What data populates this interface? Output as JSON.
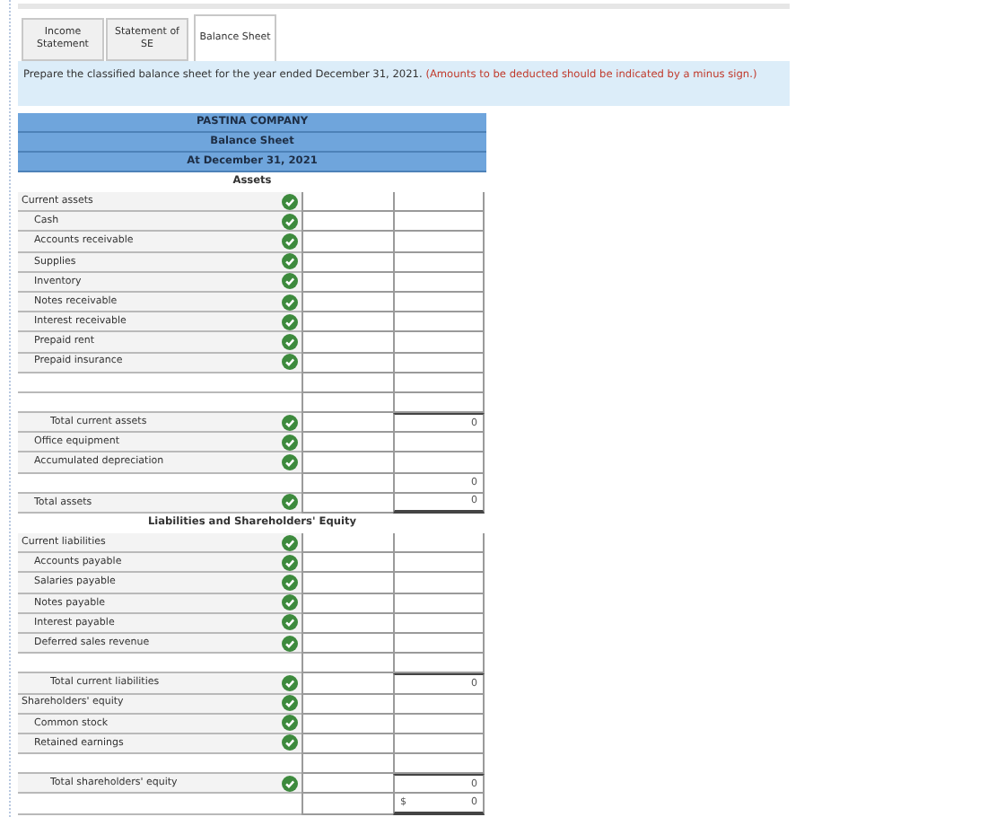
{
  "tabs": [
    {
      "label": "Income Statement",
      "selected": false
    },
    {
      "label": "Statement of SE",
      "selected": false
    },
    {
      "label": "Balance Sheet",
      "selected": true
    }
  ],
  "instructions": {
    "text": "Prepare the classified balance sheet for the year ended December 31, 2021.",
    "note": "(Amounts to be deducted should be indicated by a minus sign.)"
  },
  "sheet": {
    "title_lines": [
      "PASTINA COMPANY",
      "Balance Sheet",
      "At December 31, 2021"
    ],
    "sections": [
      {
        "title": "Assets",
        "rows": [
          {
            "kind": "heading",
            "label": "Current assets",
            "correct": true
          },
          {
            "kind": "item",
            "label": "Cash",
            "correct": true
          },
          {
            "kind": "item",
            "label": "Accounts receivable",
            "correct": true
          },
          {
            "kind": "item",
            "label": "Supplies",
            "correct": true
          },
          {
            "kind": "item",
            "label": "Inventory",
            "correct": true
          },
          {
            "kind": "item",
            "label": "Notes receivable",
            "correct": true
          },
          {
            "kind": "item",
            "label": "Interest receivable",
            "correct": true
          },
          {
            "kind": "item",
            "label": "Prepaid rent",
            "correct": true
          },
          {
            "kind": "item",
            "label": "Prepaid insurance",
            "correct": true
          },
          {
            "kind": "blank"
          },
          {
            "kind": "blank"
          },
          {
            "kind": "total",
            "label": "Total current assets",
            "correct": true,
            "amount": "0"
          },
          {
            "kind": "item",
            "label": "Office equipment",
            "correct": true
          },
          {
            "kind": "item",
            "label": "Accumulated depreciation",
            "correct": true
          },
          {
            "kind": "blank",
            "amount": "0"
          },
          {
            "kind": "item",
            "label": "Total assets",
            "correct": true,
            "amount": "0",
            "grand": true
          }
        ]
      },
      {
        "title": "Liabilities and Shareholders' Equity",
        "rows": [
          {
            "kind": "heading",
            "label": "Current liabilities",
            "correct": true
          },
          {
            "kind": "item",
            "label": "Accounts payable",
            "correct": true
          },
          {
            "kind": "item",
            "label": "Salaries payable",
            "correct": true
          },
          {
            "kind": "item",
            "label": "Notes payable",
            "correct": true
          },
          {
            "kind": "item",
            "label": "Interest payable",
            "correct": true
          },
          {
            "kind": "item",
            "label": "Deferred sales revenue",
            "correct": true
          },
          {
            "kind": "blank"
          },
          {
            "kind": "total",
            "label": "Total current liabilities",
            "correct": true,
            "amount": "0"
          },
          {
            "kind": "heading",
            "label": "Shareholders' equity",
            "correct": true
          },
          {
            "kind": "item",
            "label": "Common stock",
            "correct": true
          },
          {
            "kind": "item",
            "label": "Retained earnings",
            "correct": true
          },
          {
            "kind": "blank"
          },
          {
            "kind": "total",
            "label": "Total shareholders' equity",
            "correct": true,
            "amount": "0"
          },
          {
            "kind": "blank",
            "currency": "$",
            "amount": "0",
            "grand": true
          }
        ]
      }
    ]
  }
}
